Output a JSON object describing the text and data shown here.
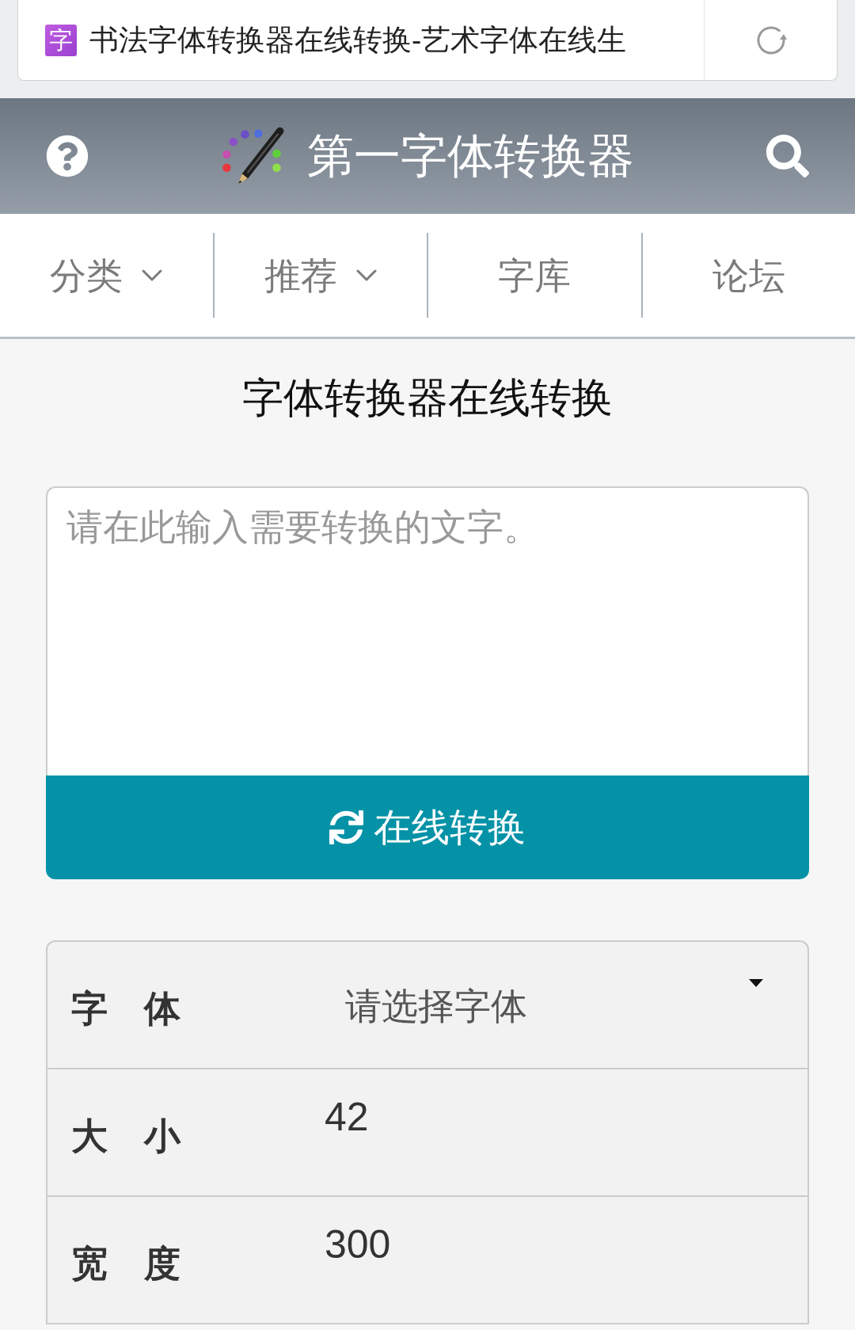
{
  "browser_bar": {
    "favicon_text": "字",
    "page_title": "书法字体转换器在线转换-艺术字体在线生"
  },
  "header": {
    "title": "第一字体转换器"
  },
  "nav": [
    {
      "label": "分类",
      "dropdown": true
    },
    {
      "label": "推荐",
      "dropdown": true
    },
    {
      "label": "字库",
      "dropdown": false
    },
    {
      "label": "论坛",
      "dropdown": false
    }
  ],
  "heading": "字体转换器在线转换",
  "text_input": {
    "placeholder": "请在此输入需要转换的文字。"
  },
  "convert_button": {
    "label": "在线转换"
  },
  "settings": [
    {
      "kind": "select",
      "label": "字　体",
      "value": "请选择字体"
    },
    {
      "kind": "input",
      "label": "大　小",
      "value": "42"
    },
    {
      "kind": "input",
      "label": "宽　度",
      "value": "300"
    }
  ]
}
